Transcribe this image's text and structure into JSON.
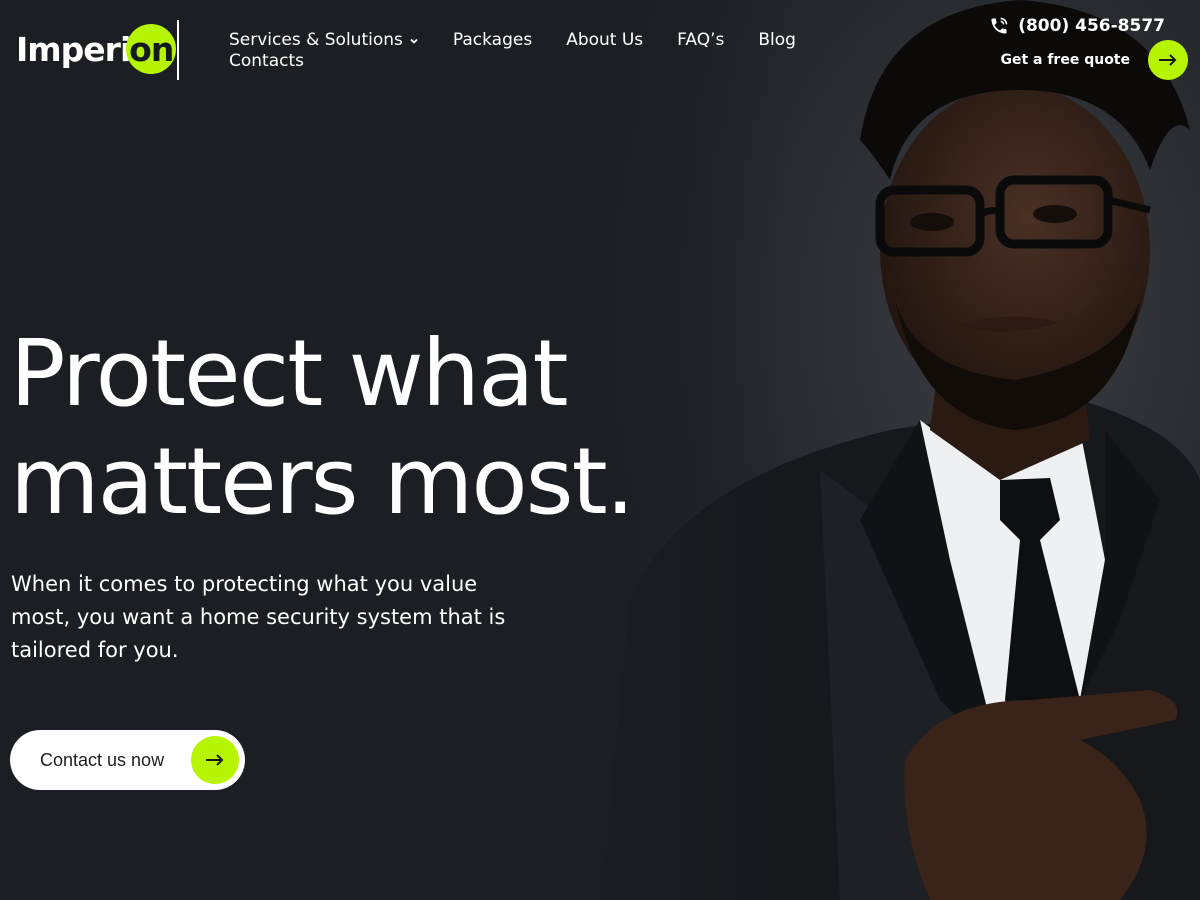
{
  "brand": {
    "name_part": "Imperi",
    "name_badge": "on",
    "accent_color": "#b7f400",
    "background_color": "#1b1e23"
  },
  "nav": {
    "items": [
      {
        "label": "Services & Solutions",
        "has_dropdown": true
      },
      {
        "label": "Packages"
      },
      {
        "label": "About Us"
      },
      {
        "label": "FAQ’s"
      },
      {
        "label": "Blog"
      },
      {
        "label": "Contacts"
      }
    ]
  },
  "header": {
    "phone": "(800) 456-8577",
    "phone_icon": "phone-icon",
    "quote_label": "Get a free quote",
    "quote_icon": "arrow-right-icon"
  },
  "hero": {
    "headline_line1": "Protect what",
    "headline_line2": "matters most.",
    "subtext": "When it comes to protecting what you value most, you want a home security system that is tailored for you.",
    "cta_label": "Contact us now",
    "cta_icon": "arrow-right-icon",
    "image": "man-in-suit-portrait"
  }
}
